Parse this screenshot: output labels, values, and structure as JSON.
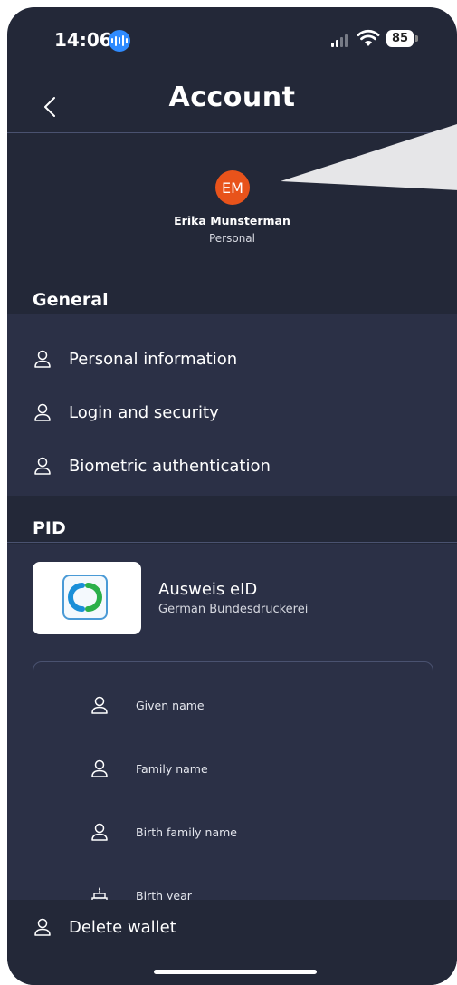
{
  "status_bar": {
    "time": "14:06",
    "battery": "85"
  },
  "header": {
    "title": "Account"
  },
  "profile": {
    "initials": "EM",
    "name": "Erika Munsterman",
    "type": "Personal"
  },
  "general": {
    "heading": "General",
    "items": [
      {
        "label": "Personal information",
        "icon": "person-icon"
      },
      {
        "label": "Login and security",
        "icon": "person-icon"
      },
      {
        "label": "Biometric authentication",
        "icon": "person-icon"
      }
    ]
  },
  "pid": {
    "heading": "PID",
    "card": {
      "title": "Ausweis eID",
      "issuer": "German Bundesdruckerei"
    },
    "fields": [
      {
        "label": "Given name",
        "icon": "person-icon"
      },
      {
        "label": "Family name",
        "icon": "person-icon"
      },
      {
        "label": "Birth family name",
        "icon": "person-icon"
      },
      {
        "label": "Birth year",
        "icon": "cake-icon"
      }
    ]
  },
  "footer": {
    "delete_label": "Delete wallet"
  },
  "colors": {
    "background": "#232838",
    "list_bg": "#2b3046",
    "avatar": "#e8531b",
    "divider": "#4a5270"
  }
}
